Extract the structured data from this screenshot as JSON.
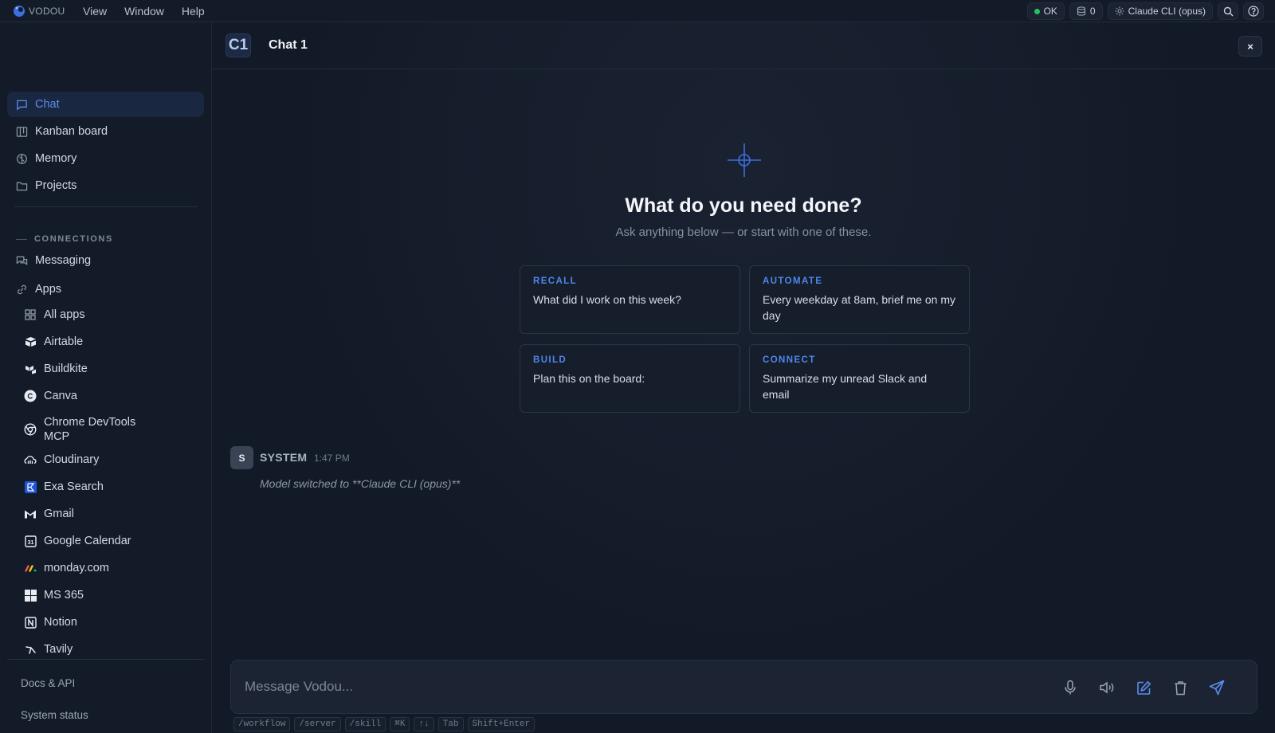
{
  "app": {
    "name": "VODOU"
  },
  "menu": [
    "View",
    "Window",
    "Help"
  ],
  "status": {
    "ok_label": "OK",
    "queue_count": "0",
    "model_label": "Claude CLI (opus)"
  },
  "sidebar": {
    "nav": [
      {
        "label": "Chat",
        "icon": "chat-bubble-icon",
        "active": true
      },
      {
        "label": "Kanban board",
        "icon": "kanban-icon"
      },
      {
        "label": "Memory",
        "icon": "brain-icon"
      },
      {
        "label": "Projects",
        "icon": "folder-icon"
      }
    ],
    "connections_label": "CONNECTIONS",
    "connections": [
      {
        "label": "Messaging",
        "icon": "messaging-icon"
      },
      {
        "label": "Apps",
        "icon": "link-icon"
      }
    ],
    "apps": [
      {
        "label": "All apps",
        "icon": "grid-icon"
      },
      {
        "label": "Airtable",
        "icon": "airtable-icon"
      },
      {
        "label": "Buildkite",
        "icon": "buildkite-icon"
      },
      {
        "label": "Canva",
        "icon": "canva-icon"
      },
      {
        "label": "Chrome DevTools MCP",
        "icon": "chrome-icon"
      },
      {
        "label": "Cloudinary",
        "icon": "cloudinary-icon"
      },
      {
        "label": "Exa Search",
        "icon": "exa-icon"
      },
      {
        "label": "Gmail",
        "icon": "gmail-icon"
      },
      {
        "label": "Google Calendar",
        "icon": "calendar-icon"
      },
      {
        "label": "monday.com",
        "icon": "monday-icon"
      },
      {
        "label": "MS 365",
        "icon": "ms365-icon"
      },
      {
        "label": "Notion",
        "icon": "notion-icon"
      },
      {
        "label": "Tavily",
        "icon": "tavily-icon"
      }
    ],
    "footer": {
      "docs": "Docs & API",
      "system_status": "System status"
    }
  },
  "chat": {
    "badge": "C1",
    "title": "Chat 1",
    "close_label": "×",
    "hero_title": "What do you need done?",
    "hero_subtitle": "Ask anything below — or start with one of these.",
    "suggestions": [
      {
        "category": "RECALL",
        "text": "What did I work on this week?"
      },
      {
        "category": "AUTOMATE",
        "text": "Every weekday at 8am, brief me on my day"
      },
      {
        "category": "BUILD",
        "text": "Plan this on the board:"
      },
      {
        "category": "CONNECT",
        "text": "Summarize my unread Slack and email"
      }
    ],
    "messages": [
      {
        "avatar": "S",
        "author": "SYSTEM",
        "time": "1:47 PM",
        "text": "Model switched to **Claude CLI (opus)**"
      }
    ]
  },
  "composer": {
    "placeholder": "Message Vodou...",
    "value": "",
    "tools": [
      "microphone-icon",
      "speaker-icon",
      "edit-icon",
      "trash-icon",
      "send-icon"
    ],
    "hints": [
      "/workflow",
      "/server",
      "/skill",
      "⌘K",
      "↑↓",
      "Tab",
      "Shift+Enter"
    ]
  },
  "colors": {
    "accent": "#5b8def",
    "status_ok": "#22c55e",
    "background": "#131a27",
    "sidebar": "#141b28"
  }
}
